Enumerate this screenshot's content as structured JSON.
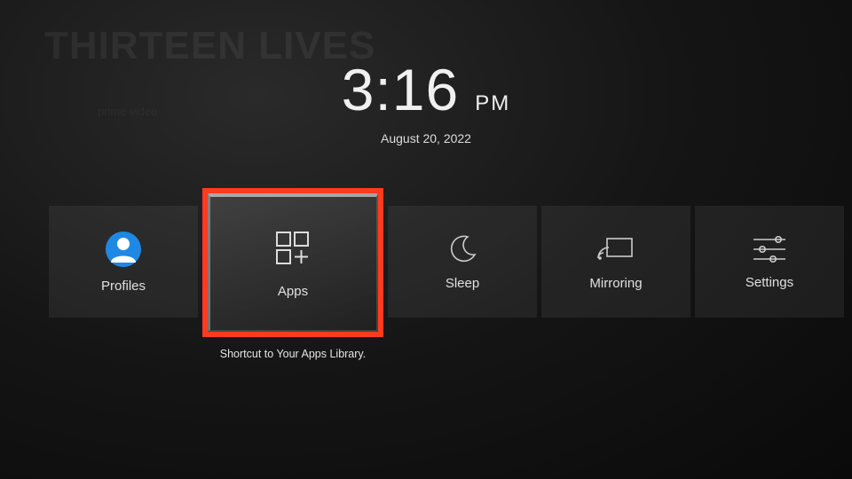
{
  "background": {
    "title": "THIRTEEN LIVES",
    "subtitle": "prime video"
  },
  "clock": {
    "time": "3:16",
    "ampm": "PM",
    "date": "August 20, 2022"
  },
  "tiles": {
    "profiles": {
      "label": "Profiles"
    },
    "apps": {
      "label": "Apps",
      "description": "Shortcut to Your Apps Library."
    },
    "sleep": {
      "label": "Sleep"
    },
    "mirroring": {
      "label": "Mirroring"
    },
    "settings": {
      "label": "Settings"
    }
  },
  "colors": {
    "focus_highlight": "#ff3b1f",
    "profile_avatar": "#1e88e5"
  }
}
